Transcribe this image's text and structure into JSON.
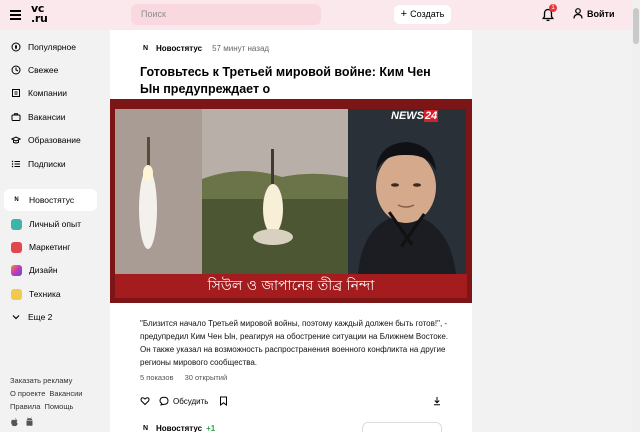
{
  "header": {
    "logo_line1": "vc",
    "logo_line2": ".ru",
    "search_placeholder": "Поиск",
    "create_label": "Создать",
    "notification_count": "1",
    "login_label": "Войти"
  },
  "sidebar": {
    "items": [
      {
        "label": "Популярное",
        "icon": "fire-icon"
      },
      {
        "label": "Свежее",
        "icon": "clock-icon"
      },
      {
        "label": "Компании",
        "icon": "building-icon"
      },
      {
        "label": "Вакансии",
        "icon": "briefcase-icon"
      },
      {
        "label": "Образование",
        "icon": "graduation-cap-icon"
      },
      {
        "label": "Подписки",
        "icon": "list-icon"
      }
    ],
    "subsites": [
      {
        "label": "Новостятус",
        "icon_text": "N",
        "color": "#ffffff"
      },
      {
        "label": "Личный опыт",
        "icon_text": "",
        "color": "#3fb3a7"
      },
      {
        "label": "Маркетинг",
        "icon_text": "",
        "color": "#e2474d"
      },
      {
        "label": "Дизайн",
        "icon_text": "",
        "color": "#c23cb7"
      },
      {
        "label": "Техника",
        "icon_text": "",
        "color": "#f2c94c"
      }
    ],
    "more_label": "Еще 2",
    "footer": {
      "advertise": "Заказать рекламу",
      "about": "О проекте",
      "vacancies": "Вакансии",
      "rules": "Правила",
      "help": "Помощь"
    }
  },
  "article": {
    "subsite_icon": "N",
    "subsite_name": "Новостятус",
    "time": "57 минут назад",
    "title": "Готовьтесь к Третьей мировой войне: Ким Чен Ын предупреждает о",
    "image": {
      "channel_logo_a": "NEWS",
      "channel_logo_b": "24",
      "caption": "সিউল ও জাপানের তীব্র নিন্দা"
    },
    "body": "\"Близится начало Третьей мировой войны, поэтому каждый должен быть готов!\", - предупредил Ким Чен Ын, реагируя на обострение ситуации на Ближнем Востоке. Он также указал на возможность распространения военного конфликта на другие регионы мирового сообщества.",
    "views": "5 показов",
    "opens": "30 открытий",
    "discuss_label": "Обсудить"
  },
  "next_post": {
    "subsite_icon": "N",
    "subsite_name": "Новостятус",
    "rating": "+1"
  },
  "colors": {
    "header_bg": "#fbe8ec",
    "search_bg": "#f9d8df",
    "badge": "#e5393d",
    "image_bg": "#7c1515"
  }
}
